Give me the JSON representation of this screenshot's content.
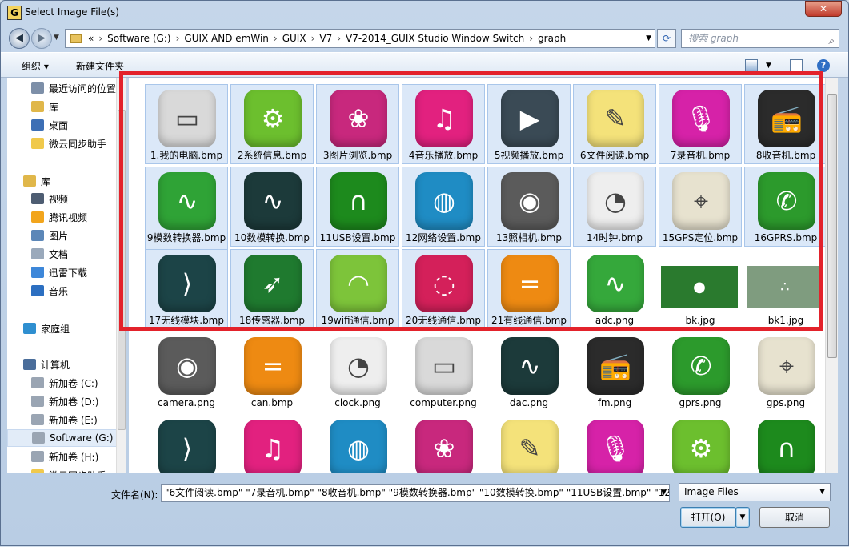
{
  "window": {
    "title": "Select Image File(s)",
    "app_badge": "G",
    "close_glyph": "✕"
  },
  "nav": {
    "back_glyph": "◀",
    "fwd_glyph": "▶",
    "drop_glyph": "▼",
    "breadcrumb": [
      "Software (G:)",
      "GUIX AND emWin",
      "GUIX",
      "V7",
      "V7-2014_GUIX Studio Window Switch",
      "graph"
    ],
    "chevron": "«",
    "sep": "›",
    "refresh_glyph": "⟳",
    "search_placeholder": "搜索 graph",
    "search_icon_glyph": "⌕"
  },
  "toolbar": {
    "organize": "组织 ▾",
    "new_folder": "新建文件夹",
    "help_glyph": "?"
  },
  "sidebar": {
    "items": [
      {
        "label": "最近访问的位置",
        "color": "#7d8fa8",
        "indent": 1
      },
      {
        "label": "库",
        "color": "#e0b74a",
        "indent": 1
      },
      {
        "label": "桌面",
        "color": "#3d6fb5",
        "indent": 1
      },
      {
        "label": "微云同步助手",
        "color": "#f0c94c",
        "indent": 1
      },
      {
        "label": "库",
        "color": "#e0b74a",
        "indent": 0
      },
      {
        "label": "视频",
        "color": "#4e5d72",
        "indent": 1
      },
      {
        "label": "腾讯视频",
        "color": "#f2a51c",
        "indent": 1
      },
      {
        "label": "图片",
        "color": "#5c87b8",
        "indent": 1
      },
      {
        "label": "文档",
        "color": "#9aa9bb",
        "indent": 1
      },
      {
        "label": "迅雷下载",
        "color": "#3d87d9",
        "indent": 1
      },
      {
        "label": "音乐",
        "color": "#2c6fc1",
        "indent": 1
      },
      {
        "label": "家庭组",
        "color": "#2f8fd0",
        "indent": 0
      },
      {
        "label": "计算机",
        "color": "#4a6d9a",
        "indent": 0
      },
      {
        "label": "新加卷 (C:)",
        "color": "#9aa5b3",
        "indent": 1
      },
      {
        "label": "新加卷 (D:)",
        "color": "#9aa5b3",
        "indent": 1
      },
      {
        "label": "新加卷 (E:)",
        "color": "#9aa5b3",
        "indent": 1
      },
      {
        "label": "Software (G:)",
        "color": "#9aa5b3",
        "indent": 1,
        "selected": true
      },
      {
        "label": "新加卷 (H:)",
        "color": "#9aa5b3",
        "indent": 1
      },
      {
        "label": "微云同步助手",
        "color": "#f0c94c",
        "indent": 1
      }
    ]
  },
  "files": [
    {
      "name": "1.我的电脑.bmp",
      "selected": true,
      "color": "#d9d9d9",
      "glyph": "▭",
      "icon": "computer-icon"
    },
    {
      "name": "2系统信息.bmp",
      "selected": true,
      "color": "#6cbf2e",
      "glyph": "⚙",
      "icon": "gear-icon"
    },
    {
      "name": "3图片浏览.bmp",
      "selected": true,
      "color": "#c8287d",
      "glyph": "❀",
      "icon": "picture-icon"
    },
    {
      "name": "4音乐播放.bmp",
      "selected": true,
      "color": "#e2217f",
      "glyph": "♫",
      "icon": "music-icon"
    },
    {
      "name": "5视频播放.bmp",
      "selected": true,
      "color": "#3a4a55",
      "glyph": "▶",
      "icon": "video-icon"
    },
    {
      "name": "6文件阅读.bmp",
      "selected": true,
      "color": "#f4e27a",
      "glyph": "✎",
      "icon": "note-icon"
    },
    {
      "name": "7录音机.bmp",
      "selected": true,
      "color": "#d622a8",
      "glyph": "🎙",
      "icon": "microphone-icon"
    },
    {
      "name": "8收音机.bmp",
      "selected": true,
      "color": "#2b2b2b",
      "glyph": "📻",
      "icon": "radio-icon"
    },
    {
      "name": "9模数转换器.bmp",
      "selected": true,
      "color": "#2fa336",
      "glyph": "∿",
      "icon": "adc-icon"
    },
    {
      "name": "10数模转换.bmp",
      "selected": true,
      "color": "#1c3a3a",
      "glyph": "∿",
      "icon": "dac-icon"
    },
    {
      "name": "11USB设置.bmp",
      "selected": true,
      "color": "#1d8a1d",
      "glyph": "∩",
      "icon": "usb-icon"
    },
    {
      "name": "12网络设置.bmp",
      "selected": true,
      "color": "#1f8cc4",
      "glyph": "◍",
      "icon": "globe-icon"
    },
    {
      "name": "13照相机.bmp",
      "selected": true,
      "color": "#5b5b5b",
      "glyph": "◉",
      "icon": "camera-icon"
    },
    {
      "name": "14时钟.bmp",
      "selected": true,
      "color": "#eeeeee",
      "glyph": "◔",
      "icon": "clock-icon"
    },
    {
      "name": "15GPS定位.bmp",
      "selected": true,
      "color": "#e7e2cf",
      "glyph": "⌖",
      "icon": "gps-icon"
    },
    {
      "name": "16GPRS.bmp",
      "selected": true,
      "color": "#2c9a2c",
      "glyph": "✆",
      "icon": "phone-icon"
    },
    {
      "name": "17无线模块.bmp",
      "selected": true,
      "color": "#1c4447",
      "glyph": "⟩",
      "icon": "swipe-icon"
    },
    {
      "name": "18传感器.bmp",
      "selected": true,
      "color": "#1f7a2f",
      "glyph": "➶",
      "icon": "compass-icon"
    },
    {
      "name": "19wifi通信.bmp",
      "selected": true,
      "color": "#7dc43a",
      "glyph": "◠",
      "icon": "wifi-icon"
    },
    {
      "name": "20无线通信.bmp",
      "selected": true,
      "color": "#d4205a",
      "glyph": "◌",
      "icon": "wireless-icon"
    },
    {
      "name": "21有线通信.bmp",
      "selected": true,
      "color": "#ee8a12",
      "glyph": "=",
      "icon": "wired-icon"
    },
    {
      "name": "adc.png",
      "selected": false,
      "color": "#35a83b",
      "glyph": "∿",
      "icon": "adc-icon"
    },
    {
      "name": "bk.jpg",
      "selected": false,
      "color": "#2a7a2e",
      "glyph": "●",
      "icon": "bk-image-icon",
      "wide": true
    },
    {
      "name": "bk1.jpg",
      "selected": false,
      "color": "#7f9c7f",
      "glyph": "∴",
      "icon": "bk1-image-icon",
      "wide": true
    },
    {
      "name": "camera.png",
      "selected": false,
      "color": "#5b5b5b",
      "glyph": "◉",
      "icon": "camera-icon"
    },
    {
      "name": "can.bmp",
      "selected": false,
      "color": "#ee8a12",
      "glyph": "=",
      "icon": "can-icon"
    },
    {
      "name": "clock.png",
      "selected": false,
      "color": "#eeeeee",
      "glyph": "◔",
      "icon": "clock-icon"
    },
    {
      "name": "computer.png",
      "selected": false,
      "color": "#d9d9d9",
      "glyph": "▭",
      "icon": "computer-icon"
    },
    {
      "name": "dac.png",
      "selected": false,
      "color": "#1c3a3a",
      "glyph": "∿",
      "icon": "dac-icon"
    },
    {
      "name": "fm.png",
      "selected": false,
      "color": "#2b2b2b",
      "glyph": "📻",
      "icon": "radio-icon"
    },
    {
      "name": "gprs.png",
      "selected": false,
      "color": "#2c9a2c",
      "glyph": "✆",
      "icon": "phone-icon"
    },
    {
      "name": "gps.png",
      "selected": false,
      "color": "#e7e2cf",
      "glyph": "⌖",
      "icon": "gps-icon"
    },
    {
      "name": "",
      "selected": false,
      "color": "#1c4447",
      "glyph": "⟩",
      "icon": "swipe-icon"
    },
    {
      "name": "",
      "selected": false,
      "color": "#e2217f",
      "glyph": "♫",
      "icon": "music-icon"
    },
    {
      "name": "",
      "selected": false,
      "color": "#1f8cc4",
      "glyph": "◍",
      "icon": "globe-icon"
    },
    {
      "name": "",
      "selected": false,
      "color": "#c8287d",
      "glyph": "❀",
      "icon": "picture-icon"
    },
    {
      "name": "",
      "selected": false,
      "color": "#f4e27a",
      "glyph": "✎",
      "icon": "note-icon"
    },
    {
      "name": "",
      "selected": false,
      "color": "#d622a8",
      "glyph": "🎙",
      "icon": "microphone-icon"
    },
    {
      "name": "",
      "selected": false,
      "color": "#6cbf2e",
      "glyph": "⚙",
      "icon": "gear-icon"
    },
    {
      "name": "",
      "selected": false,
      "color": "#1d8a1d",
      "glyph": "∩",
      "icon": "usb-icon"
    }
  ],
  "footer": {
    "filename_label": "文件名(N):",
    "filename_value": "\"6文件阅读.bmp\" \"7录音机.bmp\" \"8收音机.bmp\" \"9模数转换器.bmp\" \"10数模转换.bmp\" \"11USB设置.bmp\" \"12",
    "filetype_value": "Image Files",
    "open_label": "打开(O)",
    "cancel_label": "取消",
    "drop_glyph": "▼"
  },
  "colors": {
    "highlight_box": "#e3222b",
    "selection": "#dbe8f8"
  }
}
